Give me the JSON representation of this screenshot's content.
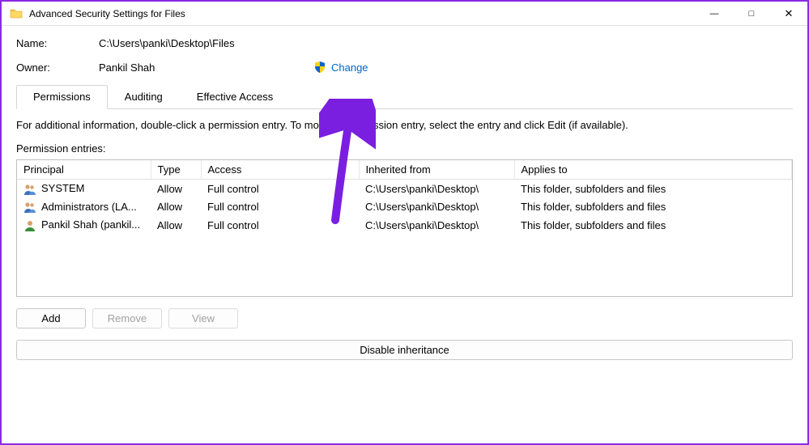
{
  "titlebar": {
    "title": "Advanced Security Settings for Files"
  },
  "info": {
    "name_label": "Name:",
    "name_value": "C:\\Users\\panki\\Desktop\\Files",
    "owner_label": "Owner:",
    "owner_value": "Pankil Shah",
    "change_label": "Change"
  },
  "tabs": {
    "permissions": "Permissions",
    "auditing": "Auditing",
    "effective": "Effective Access"
  },
  "description": "For additional information, double-click a permission entry. To modify a permission entry, select the entry and click Edit (if available).",
  "entries_label": "Permission entries:",
  "columns": {
    "principal": "Principal",
    "type": "Type",
    "access": "Access",
    "inherited": "Inherited from",
    "applies": "Applies to"
  },
  "rows": [
    {
      "icon": "group",
      "principal": "SYSTEM",
      "type": "Allow",
      "access": "Full control",
      "inherited": "C:\\Users\\panki\\Desktop\\",
      "applies": "This folder, subfolders and files"
    },
    {
      "icon": "group",
      "principal": "Administrators (LA...",
      "type": "Allow",
      "access": "Full control",
      "inherited": "C:\\Users\\panki\\Desktop\\",
      "applies": "This folder, subfolders and files"
    },
    {
      "icon": "user",
      "principal": "Pankil Shah (pankil...",
      "type": "Allow",
      "access": "Full control",
      "inherited": "C:\\Users\\panki\\Desktop\\",
      "applies": "This folder, subfolders and files"
    }
  ],
  "buttons": {
    "add": "Add",
    "remove": "Remove",
    "view": "View",
    "disable_inheritance": "Disable inheritance"
  }
}
